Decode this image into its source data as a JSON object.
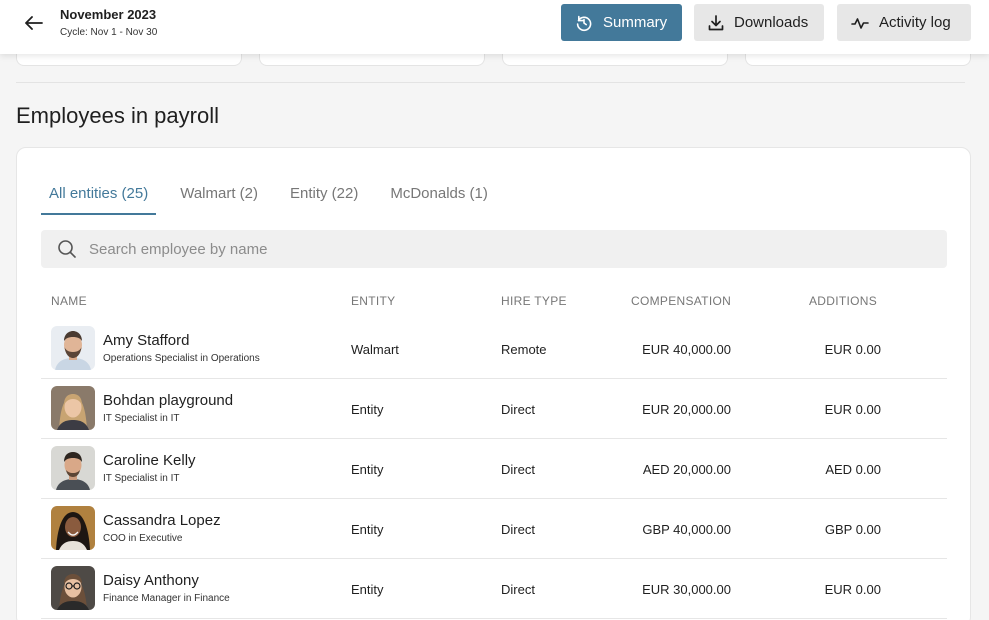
{
  "header": {
    "title": "November 2023",
    "cycle": "Cycle: Nov 1 - Nov 30",
    "buttons": {
      "summary": "Summary",
      "downloads": "Downloads",
      "activity_log": "Activity log"
    },
    "accent_color": "#43799a"
  },
  "section": {
    "title": "Employees in payroll"
  },
  "tabs": [
    {
      "label": "All entities (25)",
      "active": true
    },
    {
      "label": "Walmart (2)",
      "active": false
    },
    {
      "label": "Entity (22)",
      "active": false
    },
    {
      "label": "McDonalds (1)",
      "active": false
    }
  ],
  "search": {
    "placeholder": "Search employee by name",
    "value": ""
  },
  "table": {
    "columns": [
      "NAME",
      "ENTITY",
      "HIRE TYPE",
      "COMPENSATION",
      "ADDITIONS"
    ],
    "rows": [
      {
        "name": "Amy Stafford",
        "role": "Operations Specialist in Operations",
        "entity": "Walmart",
        "hire_type": "Remote",
        "compensation": "EUR 40,000.00",
        "additions": "EUR 0.00",
        "avatar": "man-short-beard"
      },
      {
        "name": "Bohdan playground",
        "role": "IT Specialist in IT",
        "entity": "Entity",
        "hire_type": "Direct",
        "compensation": "EUR 20,000.00",
        "additions": "EUR 0.00",
        "avatar": "woman-blonde"
      },
      {
        "name": "Caroline Kelly",
        "role": "IT Specialist in IT",
        "entity": "Entity",
        "hire_type": "Direct",
        "compensation": "AED 20,000.00",
        "additions": "AED 0.00",
        "avatar": "man-dark-hair"
      },
      {
        "name": "Cassandra Lopez",
        "role": "COO in Executive",
        "entity": "Entity",
        "hire_type": "Direct",
        "compensation": "GBP 40,000.00",
        "additions": "GBP 0.00",
        "avatar": "woman-curly-hair"
      },
      {
        "name": "Daisy Anthony",
        "role": "Finance Manager in Finance",
        "entity": "Entity",
        "hire_type": "Direct",
        "compensation": "EUR 30,000.00",
        "additions": "EUR 0.00",
        "avatar": "woman-glasses"
      }
    ]
  }
}
